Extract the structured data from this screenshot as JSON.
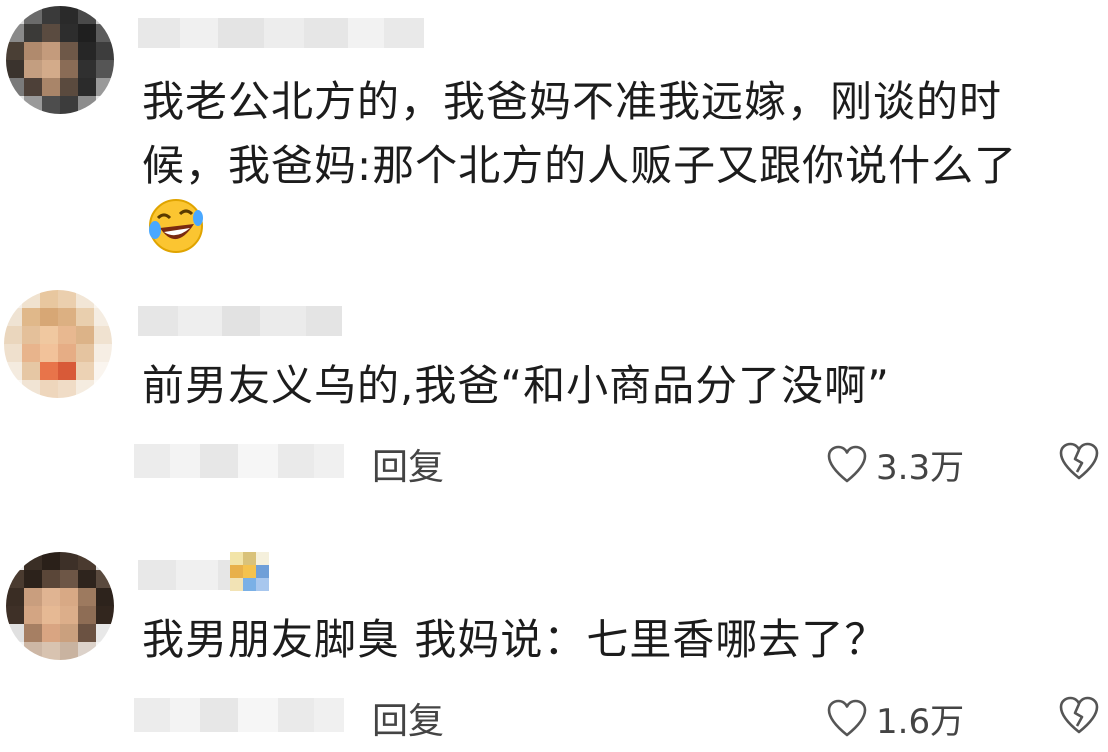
{
  "comments": [
    {
      "text_lines": [
        "我老公北方的，我爸妈不准我远嫁，刚谈的时",
        "候，我爸妈:那个北方的人贩子又跟你说什么了"
      ],
      "emoji": "laughing-crying-emoji"
    },
    {
      "text_lines": [
        "前男友义乌的,我爸“和小商品分了没啊”"
      ],
      "reply_label": "回复",
      "like_count": "3.3万"
    },
    {
      "text_lines": [
        "我男朋友脚臭 我妈说：七里香哪去了？"
      ],
      "reply_label": "回复",
      "like_count": "1.6万"
    }
  ],
  "icons": {
    "like": "heart-outline-icon",
    "dislike": "broken-heart-icon"
  },
  "colors": {
    "text": "#1c1c1c",
    "meta": "#444444",
    "background": "#ffffff"
  }
}
